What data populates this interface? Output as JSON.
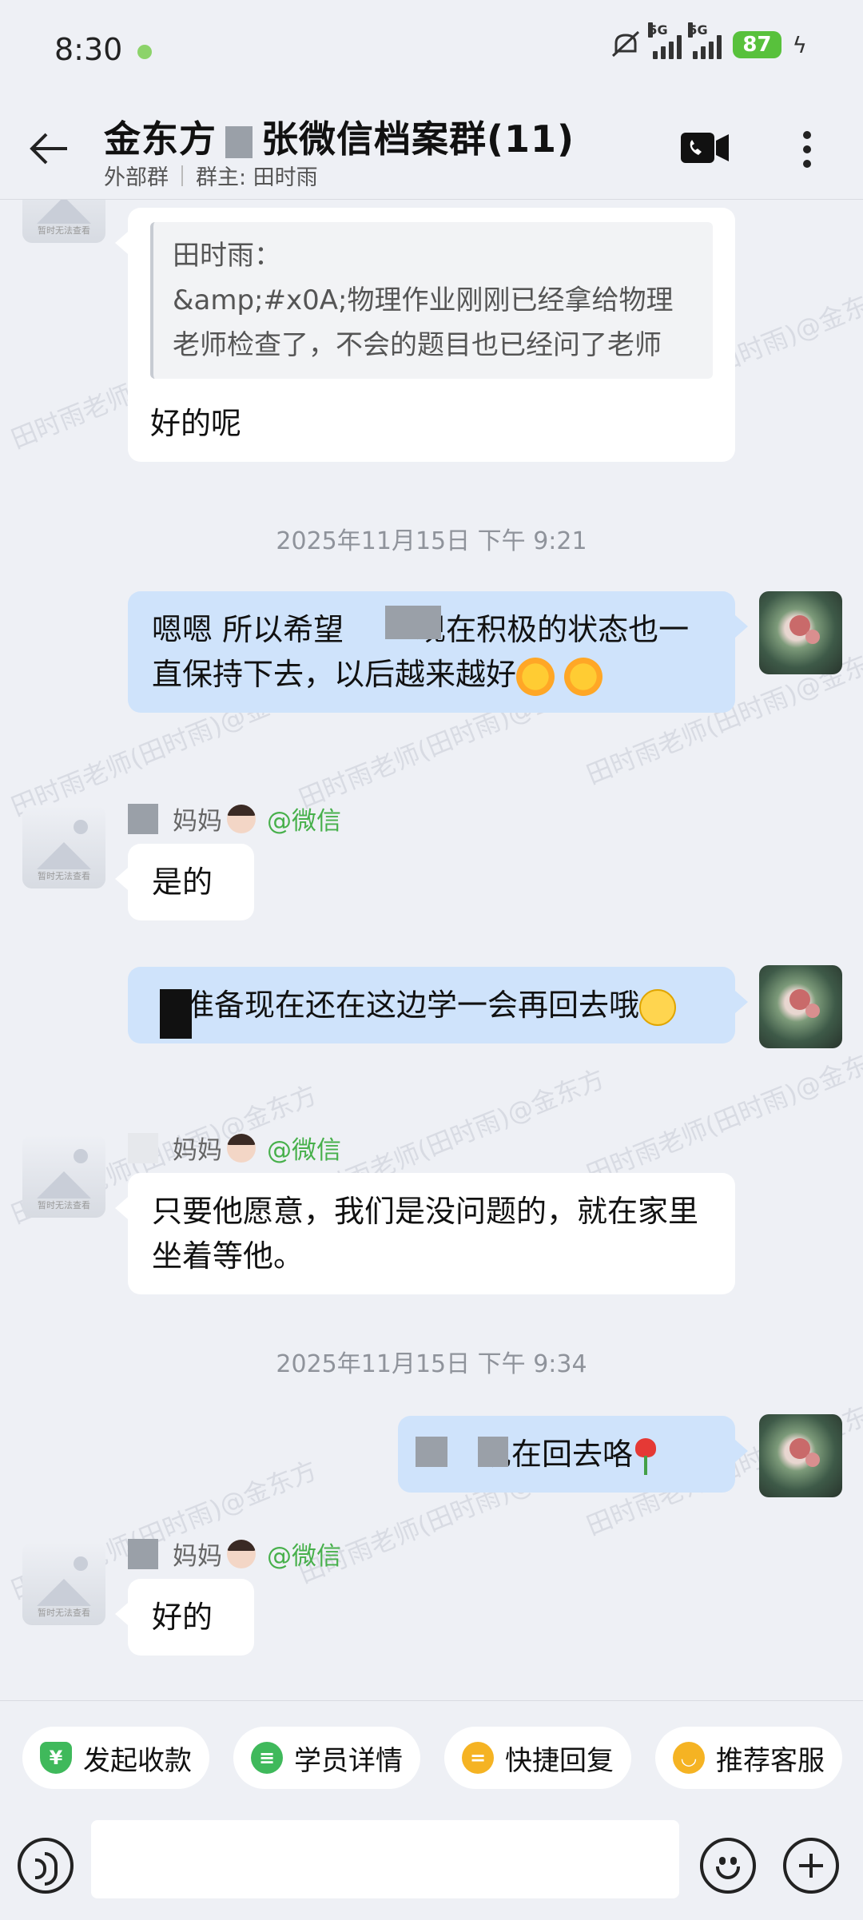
{
  "status_bar": {
    "time": "8:30",
    "net1": "5G",
    "net2": "5G",
    "battery": "87"
  },
  "header": {
    "title_part1": "金东方",
    "title_part2": "张微信档案群(11)",
    "tag": "外部群",
    "owner_label": "群主: 田时雨"
  },
  "watermarks": [
    "田时雨老师(田时雨)@金东方"
  ],
  "messages": {
    "m1_quote_name": "田时雨：",
    "m1_quote_text": "&amp;#x0A;物理作业刚刚已经拿给物理老师检查了，不会的题目也已经问了老师",
    "m1_text": "好的呢",
    "ts1": "2025年11月15日  下午 9:21",
    "m2_text_a": "嗯嗯 所以希望",
    "m2_text_b": "现在积极的状态也一直保持下去，以后越来越好",
    "m3_sender": "妈妈",
    "m3_org": "@微信",
    "m3_text": "是的",
    "m4_text_a": "准备现在还在这边学一会再回去哦",
    "m5_sender": "妈妈",
    "m5_org": "@微信",
    "m5_text": "只要他愿意，我们是没问题的，就在家里坐着等他。",
    "ts2": "2025年11月15日  下午 9:34",
    "m6_text": "现在回去咯",
    "m7_sender": "妈妈",
    "m7_org": "@微信",
    "m7_text": "好的",
    "avatar_caption": "暂时无法查看"
  },
  "quick_actions": {
    "collect": "发起收款",
    "student": "学员详情",
    "reply": "快捷回复",
    "service": "推荐客服"
  },
  "input": {
    "placeholder": ""
  },
  "colors": {
    "out_bubble": "#cfe3fb",
    "in_bubble": "#ffffff",
    "green": "#47b04b",
    "bg": "#eef0f5"
  }
}
